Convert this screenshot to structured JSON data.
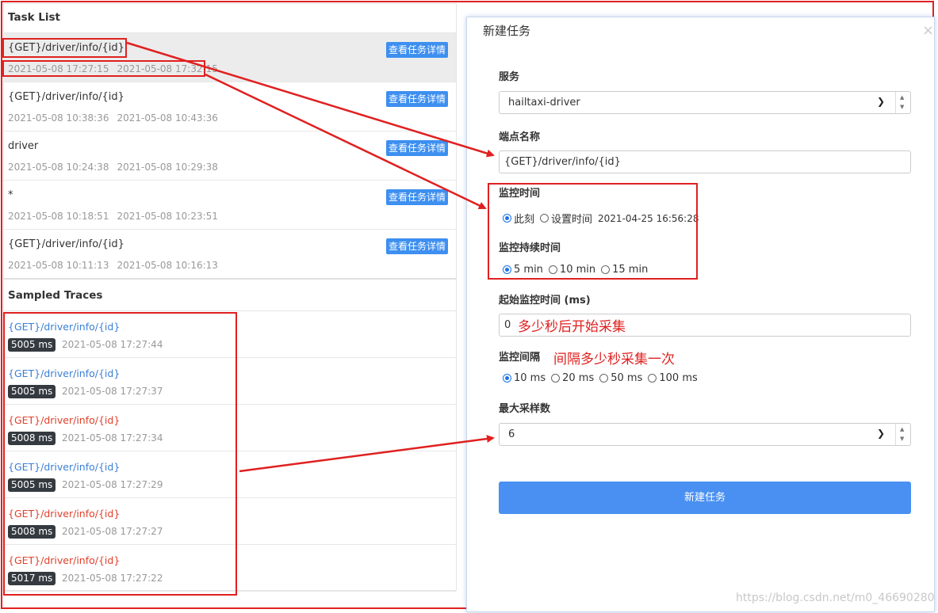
{
  "colors": {
    "annotation": "#e02020",
    "button": "#3d8ff0",
    "submit": "#4a90f2",
    "link_blue": "#3a7fd5",
    "error_red": "#e0402a"
  },
  "task_list": {
    "title": "Task List",
    "detail_label": "查看任务详情",
    "items": [
      {
        "endpoint": "{GET}/driver/info/{id}",
        "start": "2021-05-08 17:27:15",
        "end": "2021-05-08 17:32:15",
        "selected": true
      },
      {
        "endpoint": "{GET}/driver/info/{id}",
        "start": "2021-05-08 10:38:36",
        "end": "2021-05-08 10:43:36"
      },
      {
        "endpoint": "driver",
        "start": "2021-05-08 10:24:38",
        "end": "2021-05-08 10:29:38"
      },
      {
        "endpoint": "*",
        "start": "2021-05-08 10:18:51",
        "end": "2021-05-08 10:23:51"
      },
      {
        "endpoint": "{GET}/driver/info/{id}",
        "start": "2021-05-08 10:11:13",
        "end": "2021-05-08 10:16:13"
      }
    ]
  },
  "traces": {
    "title": "Sampled Traces",
    "items": [
      {
        "endpoint": "{GET}/driver/info/{id}",
        "duration": "5005 ms",
        "time": "2021-05-08 17:27:44",
        "status": "ok"
      },
      {
        "endpoint": "{GET}/driver/info/{id}",
        "duration": "5005 ms",
        "time": "2021-05-08 17:27:37",
        "status": "ok"
      },
      {
        "endpoint": "{GET}/driver/info/{id}",
        "duration": "5008 ms",
        "time": "2021-05-08 17:27:34",
        "status": "error"
      },
      {
        "endpoint": "{GET}/driver/info/{id}",
        "duration": "5005 ms",
        "time": "2021-05-08 17:27:29",
        "status": "ok"
      },
      {
        "endpoint": "{GET}/driver/info/{id}",
        "duration": "5008 ms",
        "time": "2021-05-08 17:27:27",
        "status": "error"
      },
      {
        "endpoint": "{GET}/driver/info/{id}",
        "duration": "5017 ms",
        "time": "2021-05-08 17:27:22",
        "status": "error"
      }
    ]
  },
  "modal": {
    "title": "新建任务",
    "close_icon": "×",
    "service_label": "服务",
    "service_value": "hailtaxi-driver",
    "endpoint_label": "端点名称",
    "endpoint_value": "{GET}/driver/info/{id}",
    "monitor_time_label": "监控时间",
    "monitor_time_options": [
      "此刻",
      "设置时间"
    ],
    "monitor_time_selected": "此刻",
    "monitor_time_value": "2021-04-25 16:56:28",
    "duration_label": "监控持续时间",
    "duration_options": [
      "5 min",
      "10 min",
      "15 min"
    ],
    "duration_selected": "5 min",
    "start_delay_label": "起始监控时间 (ms)",
    "start_delay_value": "0",
    "interval_label": "监控间隔",
    "interval_options": [
      "10 ms",
      "20 ms",
      "50 ms",
      "100 ms"
    ],
    "interval_selected": "10 ms",
    "max_samples_label": "最大采样数",
    "max_samples_value": "6",
    "submit_label": "新建任务"
  },
  "annotations": {
    "start_delay_note": "多少秒后开始采集",
    "interval_note": "间隔多少秒采集一次"
  },
  "watermark": "https://blog.csdn.net/m0_46690280"
}
